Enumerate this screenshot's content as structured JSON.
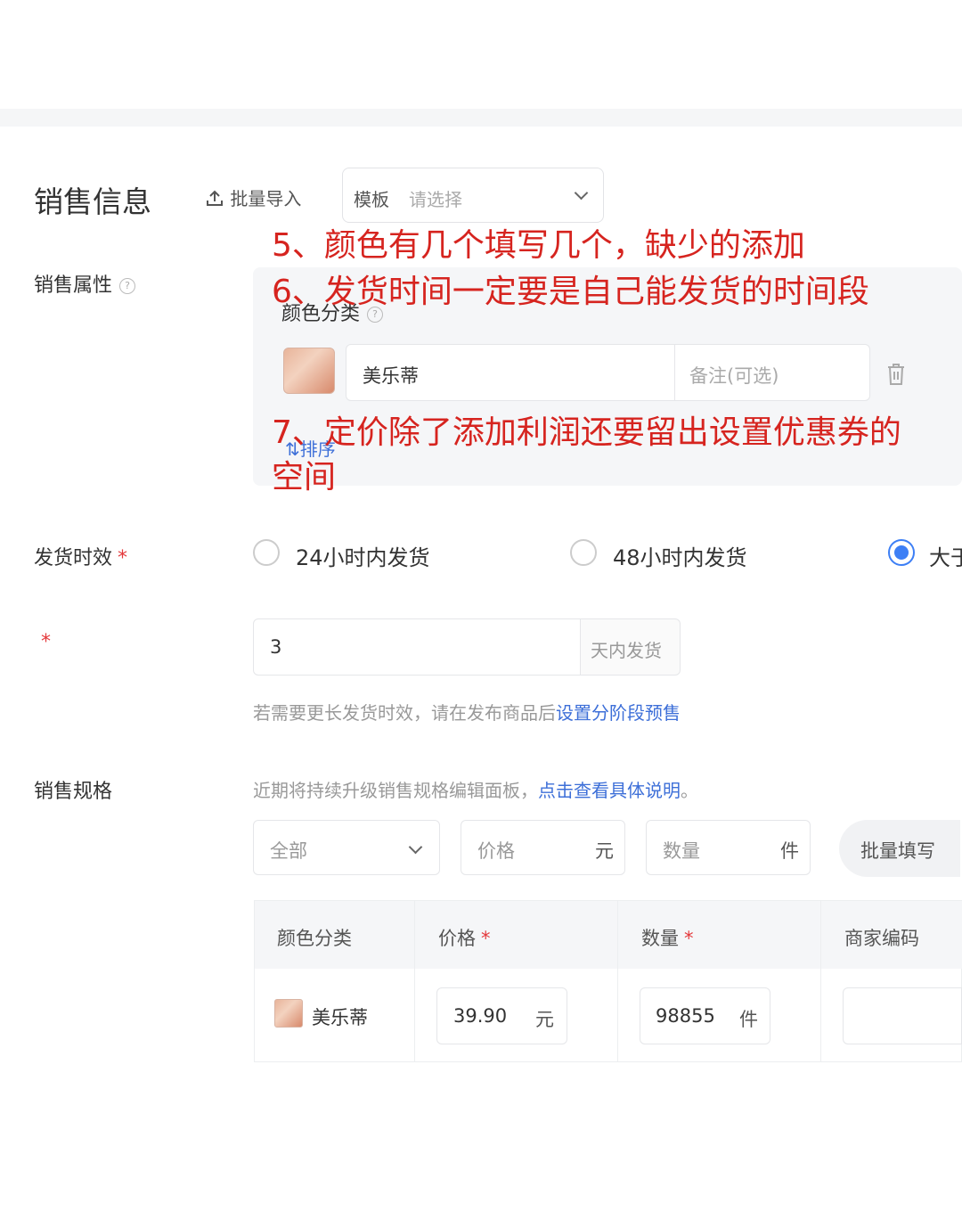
{
  "section": {
    "title": "销售信息"
  },
  "toolbar": {
    "import_label": "批量导入",
    "template_label": "模板",
    "template_placeholder": "请选择"
  },
  "annotations": {
    "a5": "5、颜色有几个填写几个，缺少的添加",
    "a6": "6、发货时间一定要是自己能发货的时间段",
    "a7_line1": "7、定价除了添加利润还要留出设置优惠券的",
    "a7_line2": "空间"
  },
  "sale_attrs": {
    "label": "销售属性",
    "color_category_label": "颜色分类",
    "item_name": "美乐蒂",
    "remark_placeholder": "备注(可选)",
    "sort_label": "排序"
  },
  "shipping": {
    "label": "发货时效",
    "required_mark": "*",
    "options": [
      "24小时内发货",
      "48小时内发货",
      "大于"
    ],
    "selected_index": 2,
    "days_value": "3",
    "days_suffix": "天内发货",
    "hint_prefix": "若需要更长发货时效，请在发布商品后",
    "hint_link": "设置分阶段预售"
  },
  "specs": {
    "label": "销售规格",
    "note": "近期将持续升级销售规格编辑面板，",
    "note_link": "点击查看具体说明",
    "note_end": "。",
    "filter_all": "全部",
    "price_placeholder": "价格",
    "price_unit": "元",
    "qty_placeholder": "数量",
    "qty_unit": "件",
    "batch_fill": "批量填写",
    "columns": [
      "颜色分类",
      "价格",
      "数量",
      "商家编码"
    ],
    "rows": [
      {
        "name": "美乐蒂",
        "price": "39.90",
        "price_unit": "元",
        "qty": "98855",
        "qty_unit": "件"
      }
    ]
  }
}
